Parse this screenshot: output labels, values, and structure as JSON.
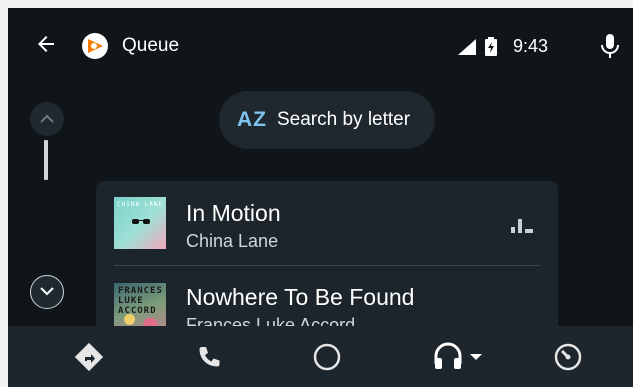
{
  "header": {
    "title": "Queue",
    "time": "9:43"
  },
  "search": {
    "icon_label": "AZ",
    "label": "Search by letter"
  },
  "queue": {
    "items": [
      {
        "title": "In Motion",
        "artist": "China Lane",
        "art_text": "CHINA LANE",
        "playing": true
      },
      {
        "title": "Nowhere To Be Found",
        "artist": "Frances Luke Accord",
        "art_text": "FRANCES LUKE ACCORD",
        "playing": false
      }
    ]
  },
  "navbar": {
    "items": [
      "navigation-icon",
      "phone-icon",
      "home-icon",
      "headphones-icon",
      "dashboard-icon"
    ]
  },
  "colors": {
    "background": "#0f1519",
    "card": "#1b252b",
    "accent": "#7ec5ee",
    "navbar": "#1c262c"
  }
}
